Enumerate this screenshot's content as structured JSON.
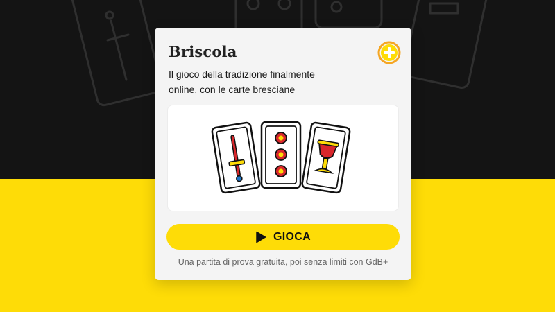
{
  "game": {
    "title": "Briscola",
    "description_lines": [
      "Il gioco della tradizione finalmente",
      "online, con le carte bresciane"
    ]
  },
  "play_button": {
    "label": "GIOCA",
    "icon": "play-icon"
  },
  "footer_note": "Una partita di prova gratuita, poi senza limiti con GdB+",
  "illustration": {
    "cards": [
      "spade-card-icon",
      "coins-card-icon",
      "cups-card-icon"
    ]
  },
  "colors": {
    "brand_yellow": "#fedc07",
    "background_dark": "#141414",
    "card_background": "#f4f4f4",
    "logo_orange": "#f5a623",
    "suit_red": "#d8262b",
    "suit_blue": "#1f75c7"
  }
}
